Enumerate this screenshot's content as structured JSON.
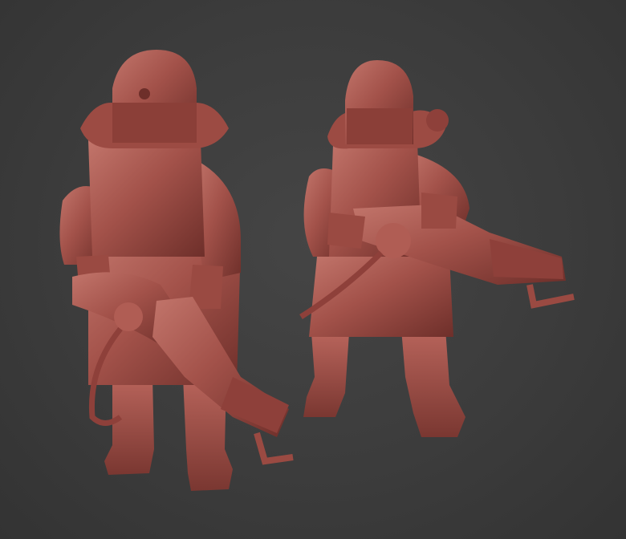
{
  "scene": {
    "background_color": "#3c3c3c",
    "model_color": "#a3524a",
    "model_shadow_color": "#6e2f2a",
    "model_highlight_color": "#c2756b",
    "figures": [
      {
        "name": "left-figure",
        "pose": "front",
        "weapon": "flamethrower-gun"
      },
      {
        "name": "right-figure",
        "pose": "three-quarter",
        "weapon": "flamethrower-gun"
      }
    ]
  }
}
